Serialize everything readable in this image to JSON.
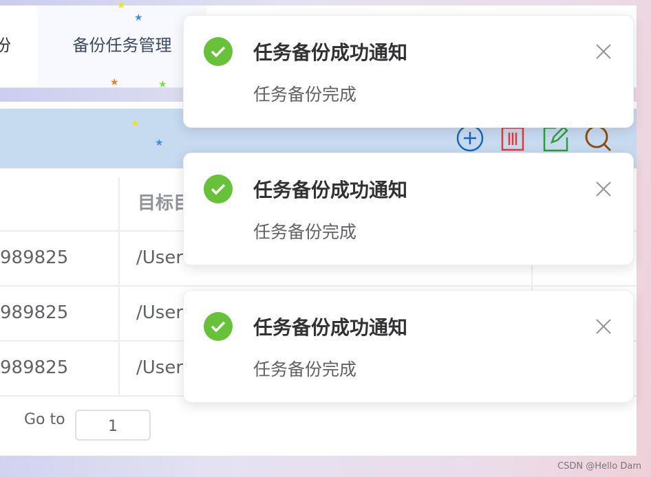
{
  "tabs": [
    {
      "label": "份"
    },
    {
      "label": "备份任务管理"
    }
  ],
  "toolbar": {
    "icons": [
      "add-icon",
      "delete-icon",
      "edit-icon",
      "search-icon"
    ]
  },
  "table": {
    "headers": [
      "",
      "目标目"
    ],
    "rows": [
      [
        "989825",
        "/User"
      ],
      [
        "989825",
        "/User"
      ],
      [
        "989825",
        "/User"
      ]
    ]
  },
  "pagination": {
    "goto_label": "Go to",
    "page": "1"
  },
  "notifications": [
    {
      "title": "任务备份成功通知",
      "message": "任务备份完成"
    },
    {
      "title": "任务备份成功通知",
      "message": "任务备份完成"
    },
    {
      "title": "任务备份成功通知",
      "message": "任务备份完成"
    }
  ],
  "watermark": "CSDN @Hello Dam",
  "colors": {
    "success": "#67c23a",
    "toolbar": "#c6daf0"
  }
}
